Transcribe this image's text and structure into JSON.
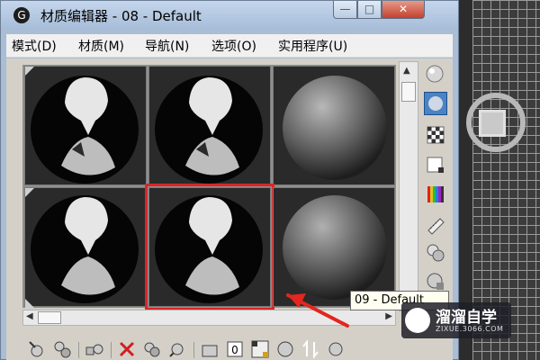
{
  "window": {
    "title": "材质编辑器 - 08 - Default",
    "app_icon_glyph": "G"
  },
  "title_buttons": {
    "minimize": "—",
    "maximize": "□",
    "close": "✕"
  },
  "menu": {
    "items": [
      {
        "label": "模式(D)"
      },
      {
        "label": "材质(M)"
      },
      {
        "label": "导航(N)"
      },
      {
        "label": "选项(O)"
      },
      {
        "label": "实用程序(U)"
      }
    ]
  },
  "sample_slots": [
    {
      "material": "08 - Default",
      "kind": "shoe-render",
      "selected": false
    },
    {
      "material": "",
      "kind": "shoe-render",
      "selected": false
    },
    {
      "material": "",
      "kind": "gray-sphere",
      "selected": false
    },
    {
      "material": "",
      "kind": "shoe-render",
      "selected": false
    },
    {
      "material": "09 - Default",
      "kind": "shoe-render",
      "selected": true
    },
    {
      "material": "",
      "kind": "gray-sphere",
      "selected": false
    }
  ],
  "side_tools": [
    {
      "icon": "sample-type-sphere-icon",
      "active": false
    },
    {
      "icon": "backlight-icon",
      "active": true
    },
    {
      "icon": "checker-background-icon",
      "active": false
    },
    {
      "icon": "sample-uv-tiling-icon",
      "active": false
    },
    {
      "icon": "video-color-check-icon",
      "active": false
    },
    {
      "icon": "make-preview-icon",
      "active": false
    },
    {
      "icon": "options-icon",
      "active": false
    },
    {
      "icon": "select-by-material-icon",
      "active": false
    }
  ],
  "bottom_tools": [
    {
      "icon": "get-material-icon"
    },
    {
      "icon": "put-to-scene-icon"
    },
    {
      "icon": "assign-to-selection-icon"
    },
    {
      "icon": "reset-map-icon"
    },
    {
      "icon": "copy-material-icon"
    },
    {
      "icon": "make-unique-icon"
    },
    {
      "icon": "put-to-library-icon"
    },
    {
      "icon": "material-id-channel-icon"
    },
    {
      "icon": "show-in-viewport-icon"
    },
    {
      "icon": "show-end-result-icon"
    },
    {
      "icon": "go-to-parent-icon"
    },
    {
      "icon": "go-forward-sibling-icon"
    }
  ],
  "material_id_channel_value": "0",
  "tooltip": "09 - Default",
  "annotation": {
    "color": "#e3261f"
  },
  "watermark": {
    "brand": "溜溜自学",
    "url": "ZIXUE.3066.COM"
  },
  "colors": {
    "titlebar": "#b4c8e2",
    "selection": "#d92626",
    "active_tool": "#4b83c4"
  }
}
